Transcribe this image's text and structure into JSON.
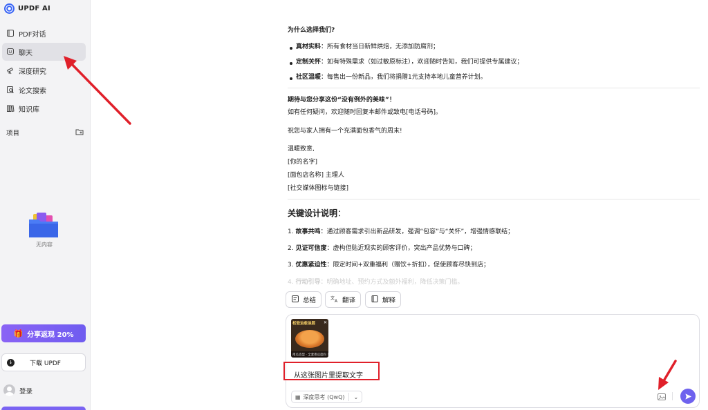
{
  "app": {
    "name": "UPDF AI"
  },
  "sidebar": {
    "items": [
      {
        "label": "PDF对话",
        "icon": "pdf-chat-icon"
      },
      {
        "label": "聊天",
        "icon": "chat-icon",
        "active": true
      },
      {
        "label": "深度研究",
        "icon": "telescope-icon"
      },
      {
        "label": "论文搜索",
        "icon": "paper-search-icon"
      },
      {
        "label": "知识库",
        "icon": "books-icon"
      }
    ],
    "projects_label": "项目",
    "empty_label": "无内容",
    "share_label": "分享返现 20%",
    "download_label": "下载 UPDF",
    "login_label": "登录"
  },
  "content": {
    "why_title": "为什么选择我们?",
    "bullets": [
      {
        "bold": "真材实料",
        "text": "：所有食材当日新鲜烘焙，无添加防腐剂；"
      },
      {
        "bold": "定制关怀",
        "text": "：如有特殊需求（如过敏原标注），欢迎随时告知，我们可提供专属建议；"
      },
      {
        "bold": "社区温暖",
        "text": "：每售出一份新品，我们将捐赠1元支持本地儿童营养计划。"
      }
    ],
    "share_title": "期待与您分享这份“没有例外的美味”！",
    "contact_line": "如有任何疑问，欢迎随时回复本邮件或致电[电话号码]。",
    "wish_line": "祝您与家人拥有一个充满面包香气的周末!",
    "regards": "温暖致意,",
    "name": "[你的名字]",
    "store": "[面包店名称] 主理人",
    "social": "[社交媒体图标与链接]",
    "design_title": "关键设计说明",
    "design_colon": "：",
    "points": [
      {
        "num": "1.",
        "bold": "故事共鸣",
        "text": "：通过顾客需求引出新品研发，强调“包容”与“关怀”，增强情感联结；"
      },
      {
        "num": "2.",
        "bold": "见证可信度",
        "text": "：虚构但贴近现实的顾客评价，突出产品优势与口碑；"
      },
      {
        "num": "3.",
        "bold": "优惠紧迫性",
        "text": "：限定时间+双重福利（赠饮+折扣），促使顾客尽快到店；"
      },
      {
        "num": "4.",
        "bold": "行动引导",
        "text": "：明确地址、预约方式及额外福利，降低决策门槛。"
      }
    ]
  },
  "quick_actions": [
    {
      "label": "总结",
      "icon": "summary-icon"
    },
    {
      "label": "翻译",
      "icon": "translate-icon"
    },
    {
      "label": "解释",
      "icon": "book-icon"
    }
  ],
  "composer": {
    "thumbnail_title": "松软治愈涂层",
    "thumbnail_footer": "南瓜造型 · 全麦南瓜面包 新品上市",
    "prompt": "从这张图片里提取文字",
    "mode_label": "深度思考 (QwQ)"
  },
  "colors": {
    "accent": "#6e62ee",
    "annotation": "#e0202a",
    "sidebar_bg": "#f3f3f5"
  }
}
